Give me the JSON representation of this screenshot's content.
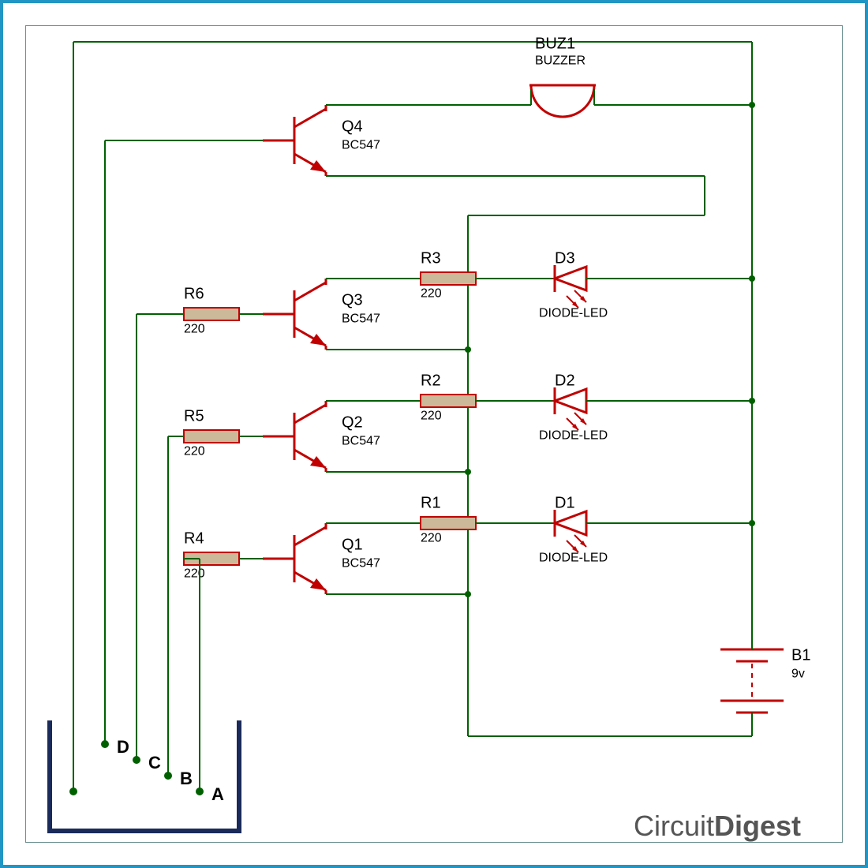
{
  "watermark": {
    "part1": "Circuit",
    "part2": "Digest"
  },
  "buzzer": {
    "ref": "BUZ1",
    "type": "BUZZER"
  },
  "battery": {
    "ref": "B1",
    "value": "9v"
  },
  "stages": [
    {
      "q_ref": "Q1",
      "q_type": "BC547",
      "rcol_ref": "R1",
      "rcol_val": "220",
      "rbase_ref": "R4",
      "rbase_val": "220",
      "d_ref": "D1",
      "d_type": "DIODE-LED",
      "probe": "A"
    },
    {
      "q_ref": "Q2",
      "q_type": "BC547",
      "rcol_ref": "R2",
      "rcol_val": "220",
      "rbase_ref": "R5",
      "rbase_val": "220",
      "d_ref": "D2",
      "d_type": "DIODE-LED",
      "probe": "B"
    },
    {
      "q_ref": "Q3",
      "q_type": "BC547",
      "rcol_ref": "R3",
      "rcol_val": "220",
      "rbase_ref": "R6",
      "rbase_val": "220",
      "d_ref": "D3",
      "d_type": "DIODE-LED",
      "probe": "C"
    }
  ],
  "top": {
    "q_ref": "Q4",
    "q_type": "BC547",
    "probe": "D"
  },
  "tank": {
    "label": ""
  }
}
